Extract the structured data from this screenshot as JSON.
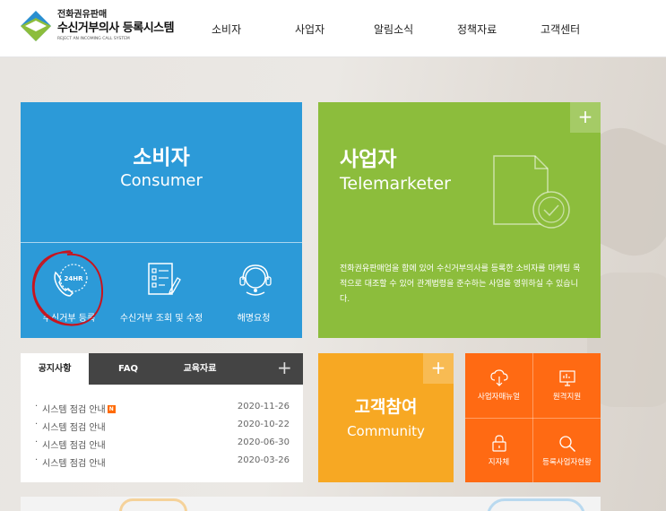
{
  "header": {
    "logo_sub": "전화권유판매",
    "logo_title": "수신거부의사 등록시스템",
    "logo_eng": "REJECT AN INCOMING CALL SYSTEM",
    "nav": [
      "소비자",
      "사업자",
      "알림소식",
      "정책자료",
      "고객센터"
    ]
  },
  "consumer": {
    "title_ko": "소비자",
    "title_en": "Consumer",
    "items": [
      {
        "label": "수신거부 등록",
        "icon": "phone-24hr-icon",
        "icon_text": "24HR"
      },
      {
        "label": "수신거부 조회 및 수정",
        "icon": "checklist-edit-icon"
      },
      {
        "label": "해명요청",
        "icon": "headset-agent-icon"
      }
    ]
  },
  "business": {
    "title_ko": "사업자",
    "title_en": "Telemarketer",
    "description": "전화권유판매업을 함에 있어 수신거부의사를 등록한 소비자를 마케팅 목적으로 대조할 수 있어 관계법령을 준수하는 사업을 영위하실 수 있습니다.",
    "more": "+"
  },
  "notice": {
    "tabs": [
      "공지사항",
      "FAQ",
      "교육자료"
    ],
    "more": "+",
    "new_badge": "N",
    "rows": [
      {
        "title": "시스템 점검 안내",
        "date": "2020-11-26",
        "is_new": true
      },
      {
        "title": "시스템 점검 안내",
        "date": "2020-10-22",
        "is_new": false
      },
      {
        "title": "시스템 점검 안내",
        "date": "2020-06-30",
        "is_new": false
      },
      {
        "title": "시스템 점검 안내",
        "date": "2020-03-26",
        "is_new": false
      }
    ]
  },
  "community": {
    "title_ko": "고객참여",
    "title_en": "Community",
    "more": "+"
  },
  "quick_links": [
    {
      "label": "사업자매뉴얼",
      "icon": "cloud-download-icon"
    },
    {
      "label": "원격지원",
      "icon": "monitor-icon"
    },
    {
      "label": "지자체",
      "icon": "lock-icon"
    },
    {
      "label": "등록사업자현황",
      "icon": "search-icon"
    }
  ],
  "colors": {
    "consumer": "#2c9ad8",
    "business": "#8cbd3c",
    "community": "#f7a823",
    "quick": "#ff6a13",
    "annotation": "#c8141e"
  }
}
